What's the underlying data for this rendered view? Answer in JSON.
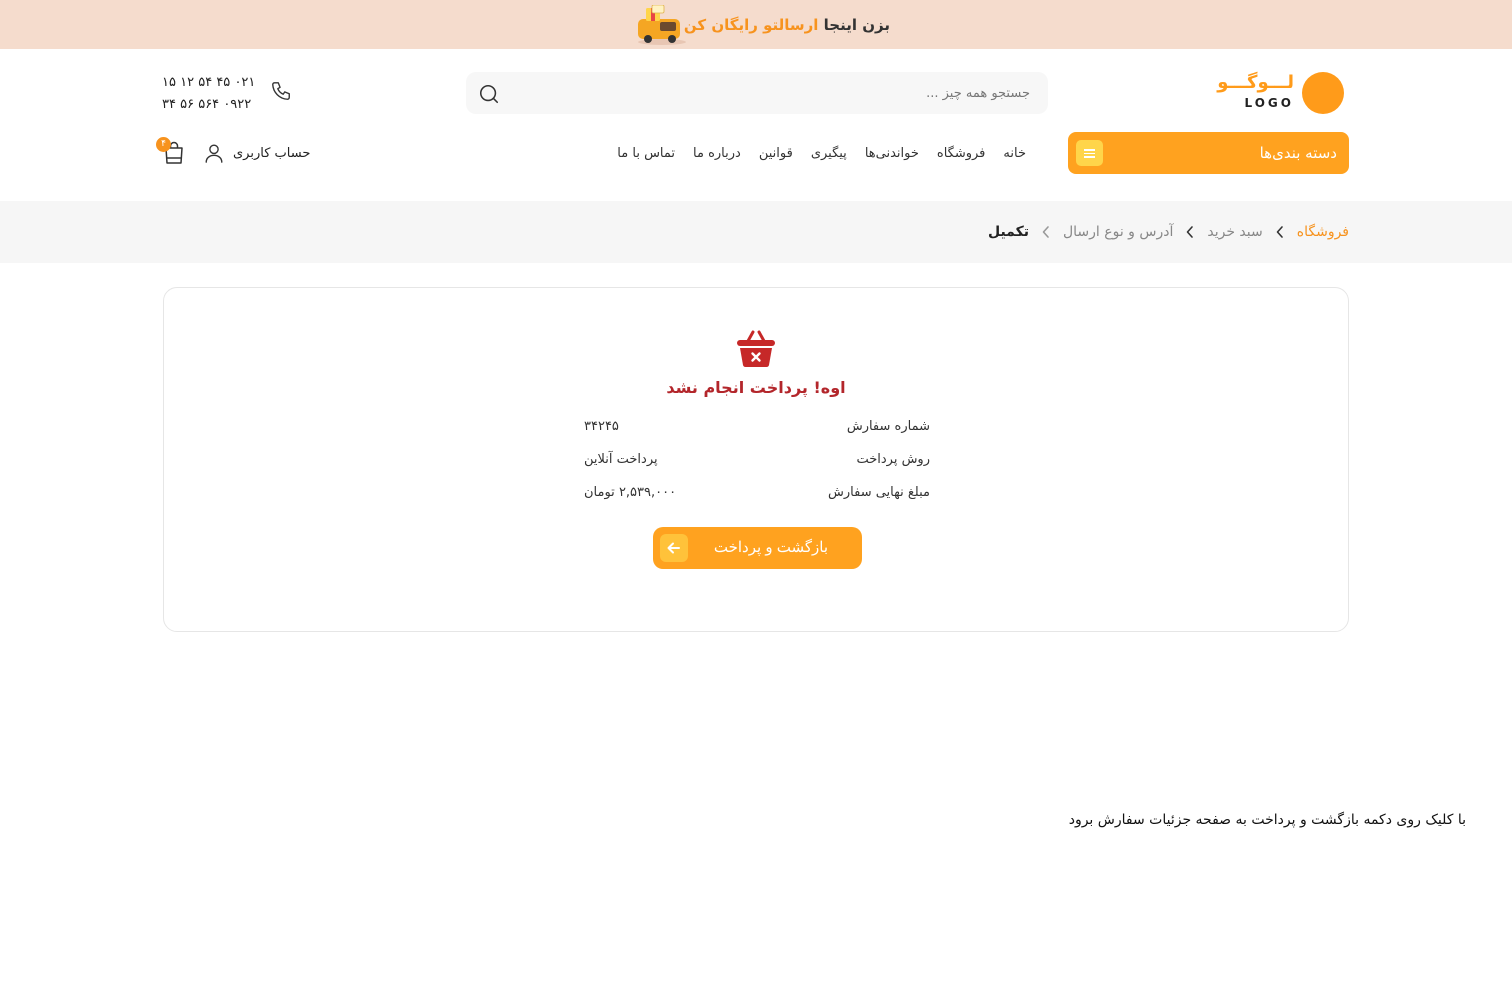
{
  "promo": {
    "text_dark": "بزن اینجا",
    "text_accent": "ارسالتو رایگان کن"
  },
  "header": {
    "logo_word": "لـــوگـــو",
    "logo_sub": "LOGO",
    "search_placeholder": "جستجو همه چیز ...",
    "phones": [
      "۰۲۱ ۴۵ ۵۴ ۱۲ ۱۵",
      "۰۹۲۲ ۵۶۴ ۵۶ ۳۴"
    ]
  },
  "nav": {
    "categories_label": "دسته بندی‌ها",
    "items": [
      "خانه",
      "فروشگاه",
      "خواندنی‌ها",
      "پیگیری",
      "قوانین",
      "درباره ما",
      "تماس با ما"
    ],
    "account_label": "حساب کاربری",
    "cart_count": "۴"
  },
  "breadcrumb": [
    "فروشگاه",
    "سبد خرید",
    "آدرس و نوع ارسال",
    "تکمیل"
  ],
  "result": {
    "title": "اوه! پرداخت انجام نشد",
    "rows": [
      {
        "label": "شماره سفارش",
        "value": "۳۴۲۴۵"
      },
      {
        "label": "روش پرداخت",
        "value": "پرداخت آنلاین"
      },
      {
        "label": "مبلغ نهایی سفارش",
        "value": "۲,۵۳۹,۰۰۰ تومان"
      }
    ],
    "button_label": "بازگشت و پرداخت"
  },
  "footnote": "با کلیک روی دکمه بازگشت و پرداخت به صفحه جزئیات سفارش برود",
  "colors": {
    "accent": "#ffa21f",
    "promo_bg": "#f5dccd",
    "error": "#b3262b"
  }
}
